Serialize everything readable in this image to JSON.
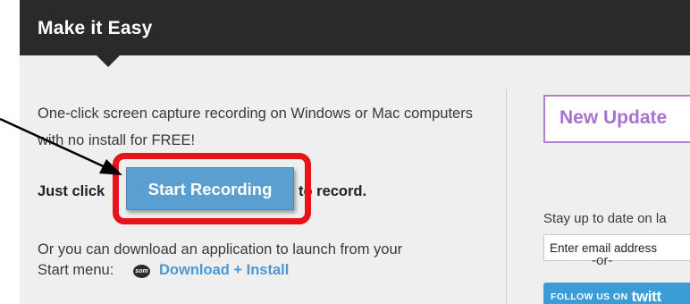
{
  "header": {
    "title": "Make it Easy"
  },
  "main": {
    "description": "One-click screen capture recording on Windows or Mac computers with no install for FREE!",
    "just_click": "Just click",
    "start_button_label": "Start Recording",
    "to_record": "to record.",
    "or_text": "Or you can download an application to launch from your",
    "start_menu_label": "Start menu:",
    "download_icon_text": "som",
    "download_link": "Download + Install"
  },
  "sidebar": {
    "new_update": "New Update",
    "stay_text": "Stay up to date on la",
    "email_placeholder": "Enter email address",
    "or_text": "-or-",
    "follow_label": "FOLLOW US ON",
    "twitter_word": "twitt"
  },
  "colors": {
    "header_bg": "#2a2a2a",
    "panel_bg": "#efefef",
    "highlight_red": "#e8141b",
    "button_blue": "#5b9fd0",
    "link_blue": "#4f97d1",
    "update_purple": "#a673cf",
    "follow_blue": "#3a9dd8"
  }
}
